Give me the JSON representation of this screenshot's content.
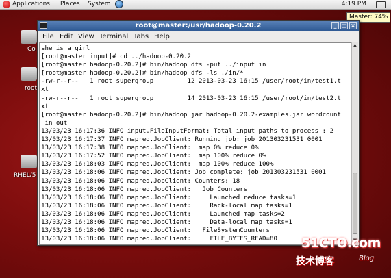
{
  "top_panel": {
    "applications": "Applications",
    "places": "Places",
    "system": "System",
    "clock": "4:19 PM"
  },
  "tooltip": "Master: 74%",
  "desktop": {
    "icon1_label": "Co",
    "icon2_label": "root",
    "icon3_label": "RHEL/5"
  },
  "window": {
    "title": "root@master:/usr/hadoop-0.20.2",
    "menu": [
      "File",
      "Edit",
      "View",
      "Terminal",
      "Tabs",
      "Help"
    ]
  },
  "terminal": {
    "lines": [
      "she is a girl",
      "[root@master input]# cd ../hadoop-0.20.2",
      "[root@master hadoop-0.20.2]# bin/hadoop dfs -put ../input in",
      "[root@master hadoop-0.20.2]# bin/hadoop dfs -ls ./in/*",
      "-rw-r--r--   1 root supergroup         12 2013-03-23 16:15 /user/root/in/test1.t",
      "xt",
      "-rw-r--r--   1 root supergroup         14 2013-03-23 16:15 /user/root/in/test2.t",
      "xt",
      "[root@master hadoop-0.20.2]# bin/hadoop jar hadoop-0.20.2-examples.jar wordcount",
      " in out",
      "13/03/23 16:17:36 INFO input.FileInputFormat: Total input paths to process : 2",
      "13/03/23 16:17:37 INFO mapred.JobClient: Running job: job_201303231531_0001",
      "13/03/23 16:17:38 INFO mapred.JobClient:  map 0% reduce 0%",
      "13/03/23 16:17:52 INFO mapred.JobClient:  map 100% reduce 0%",
      "13/03/23 16:18:03 INFO mapred.JobClient:  map 100% reduce 100%",
      "13/03/23 16:18:06 INFO mapred.JobClient: Job complete: job_201303231531_0001",
      "13/03/23 16:18:06 INFO mapred.JobClient: Counters: 18",
      "13/03/23 16:18:06 INFO mapred.JobClient:   Job Counters",
      "13/03/23 16:18:06 INFO mapred.JobClient:     Launched reduce tasks=1",
      "13/03/23 16:18:06 INFO mapred.JobClient:     Rack-local map tasks=1",
      "13/03/23 16:18:06 INFO mapred.JobClient:     Launched map tasks=2",
      "13/03/23 16:18:06 INFO mapred.JobClient:     Data-local map tasks=1",
      "13/03/23 16:18:06 INFO mapred.JobClient:   FileSystemCounters",
      "13/03/23 16:18:06 INFO mapred.JobClient:     FILE_BYTES_READ=80"
    ]
  },
  "watermark": {
    "site": "51CTO.com",
    "tagline": "技术博客",
    "blog": "Blog"
  }
}
